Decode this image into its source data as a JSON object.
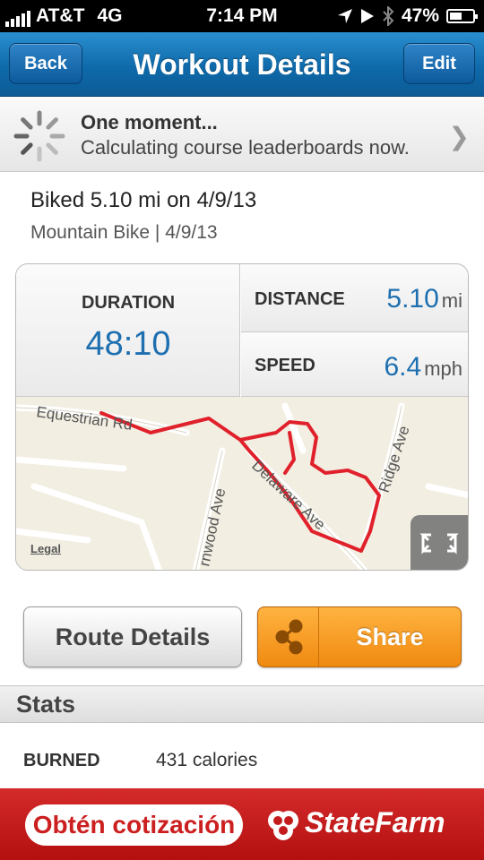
{
  "status_bar": {
    "carrier": "AT&T",
    "network": "4G",
    "time": "7:14 PM",
    "battery": "47%",
    "battery_level": 0.47
  },
  "nav": {
    "back_label": "Back",
    "title": "Workout Details",
    "edit_label": "Edit"
  },
  "banner": {
    "title": "One moment...",
    "message": "Calculating course leaderboards now."
  },
  "workout": {
    "title": "Biked 5.10 mi on 4/9/13",
    "subtitle": "Mountain Bike | 4/9/13"
  },
  "stats_card": {
    "duration_label": "DURATION",
    "duration_value": "48:10",
    "distance_label": "DISTANCE",
    "distance_value": "5.10",
    "distance_unit": "mi",
    "speed_label": "SPEED",
    "speed_value": "6.4",
    "speed_unit": "mph"
  },
  "map": {
    "streets": [
      "Equestrian Rd",
      "rnwood Ave",
      "Delaware Ave",
      "Ridge Ave"
    ],
    "legal": "Legal",
    "route_color": "#e0212b"
  },
  "buttons": {
    "route_details": "Route Details",
    "share": "Share"
  },
  "stats": {
    "heading": "Stats",
    "burned_label": "BURNED",
    "burned_value": "431 calories"
  },
  "ad": {
    "cta": "Obtén cotización",
    "brand": "StateFarm"
  },
  "colors": {
    "accent_blue": "#1d6fb0",
    "share_orange": "#f08a10",
    "ad_red": "#c41c1c"
  }
}
